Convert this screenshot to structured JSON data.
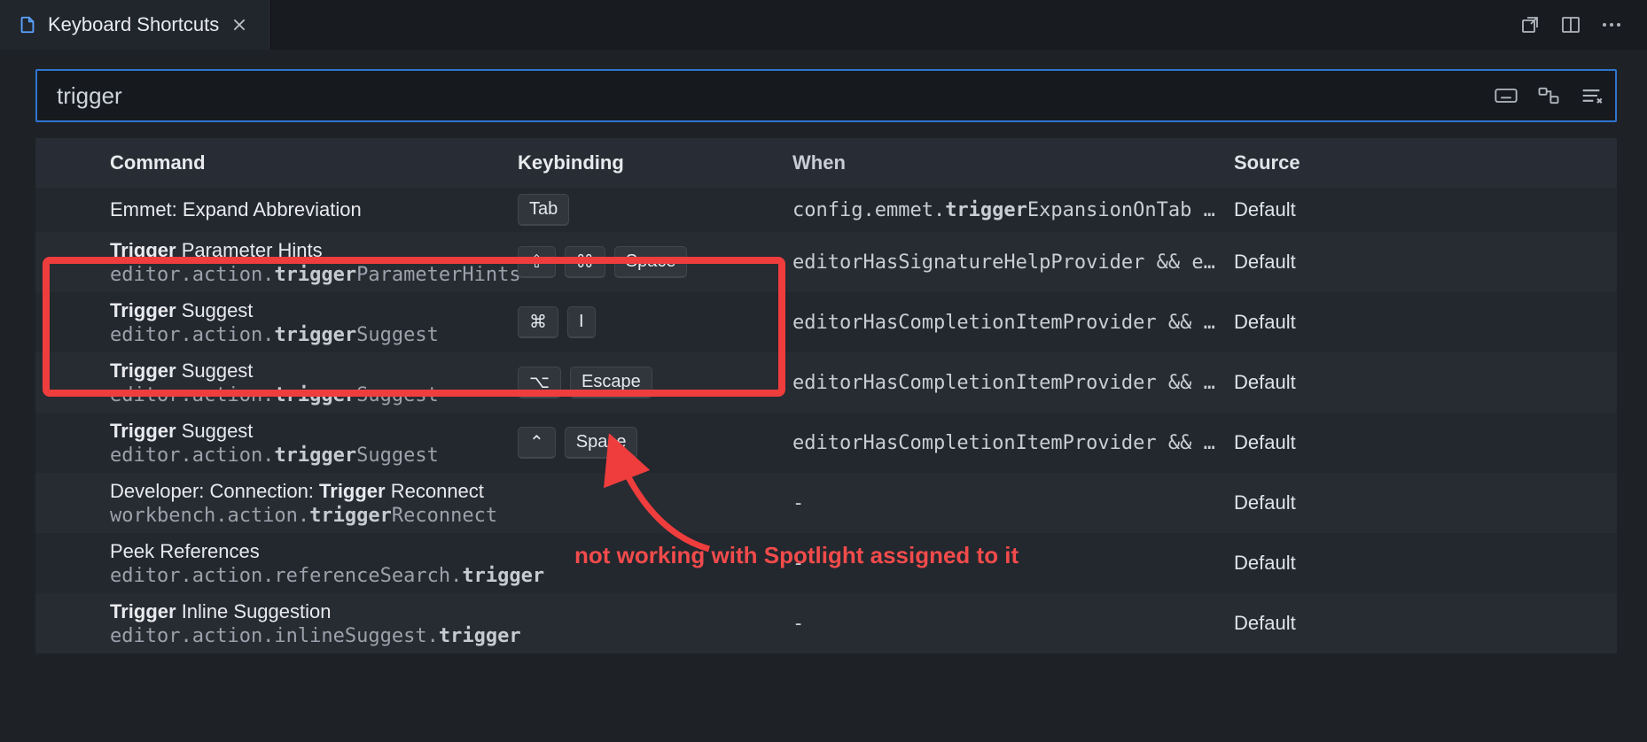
{
  "tab": {
    "title": "Keyboard Shortcuts"
  },
  "search": {
    "value": "trigger"
  },
  "columns": {
    "command": "Command",
    "keybinding": "Keybinding",
    "when": "When",
    "source": "Source"
  },
  "rows": [
    {
      "command_html": "Emmet: Expand Abbreviation",
      "id_html": "",
      "single": true,
      "keys": [
        "Tab"
      ],
      "when_html": "config.emmet.<b>trigger</b>ExpansionOnTab && e…",
      "source": "Default"
    },
    {
      "command_html": "<b>Trigger</b> Parameter Hints",
      "id_html": "editor.action.<b>trigger</b>ParameterHints",
      "keys": [
        "⇧",
        "⌘",
        "Space"
      ],
      "when_html": "editorHasSignatureHelpProvider && edito…",
      "source": "Default"
    },
    {
      "command_html": "<b>Trigger</b> Suggest",
      "id_html": "editor.action.<b>trigger</b>Suggest",
      "keys": [
        "⌘",
        "I"
      ],
      "when_html": "editorHasCompletionItemProvider && text…",
      "source": "Default"
    },
    {
      "command_html": "<b>Trigger</b> Suggest",
      "id_html": "editor.action.<b>trigger</b>Suggest",
      "keys": [
        "⌥",
        "Escape"
      ],
      "when_html": "editorHasCompletionItemProvider && text…",
      "source": "Default"
    },
    {
      "command_html": "<b>Trigger</b> Suggest",
      "id_html": "editor.action.<b>trigger</b>Suggest",
      "keys": [
        "⌃",
        "Space"
      ],
      "when_html": "editorHasCompletionItemProvider && text…",
      "source": "Default"
    },
    {
      "command_html": "Developer: Connection: <b>Trigger</b> Reconnect",
      "id_html": "workbench.action.<b>trigger</b>Reconnect",
      "keys": [],
      "when_html": "-",
      "source": "Default"
    },
    {
      "command_html": "Peek References",
      "id_html": "editor.action.referenceSearch.<b>trigger</b>",
      "keys": [],
      "when_html": "-",
      "source": "Default"
    },
    {
      "command_html": "<b>Trigger</b> Inline Suggestion",
      "id_html": "editor.action.inlineSuggest.<b>trigger</b>",
      "keys": [],
      "when_html": "-",
      "source": "Default"
    }
  ],
  "annotation": {
    "text": "not working with Spotlight assigned to it"
  }
}
